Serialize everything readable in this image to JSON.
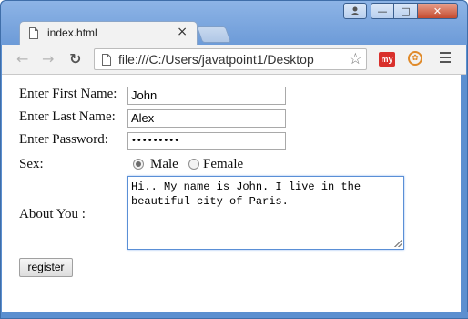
{
  "browser": {
    "tab_title": "index.html",
    "tab_close": "×",
    "url": "file:///C:/Users/javatpoint1/Desktop",
    "ext_my_label": "my",
    "ext_circle_label": "✿",
    "star": "☆"
  },
  "window_controls": {
    "minimize": "—",
    "maximize": "□",
    "close": "✕",
    "user": "👤"
  },
  "form": {
    "first_name_label": "Enter First Name:",
    "first_name_value": "John",
    "last_name_label": "Enter Last Name:",
    "last_name_value": "Alex",
    "password_label": "Enter Password:",
    "password_value": "•••••••••",
    "sex_label": "Sex:",
    "sex_options": [
      {
        "label": "Male",
        "checked": true
      },
      {
        "label": "Female",
        "checked": false
      }
    ],
    "about_label": "About You :",
    "about_value": "Hi.. My name is John. I live in the beautiful city of Paris.",
    "register_label": "register"
  }
}
